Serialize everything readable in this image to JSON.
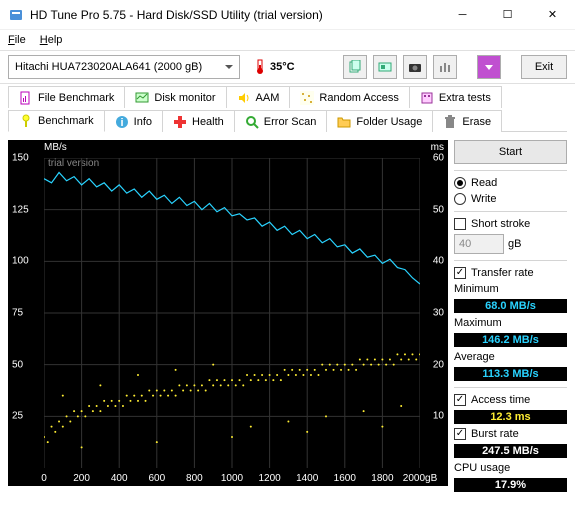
{
  "window": {
    "title": "HD Tune Pro 5.75 - Hard Disk/SSD Utility (trial version)"
  },
  "menu": {
    "file": "File",
    "help": "Help"
  },
  "toolbar": {
    "drive": "Hitachi HUA723020ALA641 (2000 gB)",
    "temp": "35°C",
    "exit": "Exit"
  },
  "tabs_row1": [
    {
      "label": "File Benchmark"
    },
    {
      "label": "Disk monitor"
    },
    {
      "label": "AAM"
    },
    {
      "label": "Random Access"
    },
    {
      "label": "Extra tests"
    }
  ],
  "tabs_row2": [
    {
      "label": "Benchmark"
    },
    {
      "label": "Info"
    },
    {
      "label": "Health"
    },
    {
      "label": "Error Scan"
    },
    {
      "label": "Folder Usage"
    },
    {
      "label": "Erase"
    }
  ],
  "side": {
    "start": "Start",
    "read": "Read",
    "write": "Write",
    "short_stroke": "Short stroke",
    "short_stroke_val": "40",
    "gb": "gB",
    "transfer_rate": "Transfer rate",
    "minimum": "Minimum",
    "min_val": "68.0 MB/s",
    "maximum": "Maximum",
    "max_val": "146.2 MB/s",
    "average": "Average",
    "avg_val": "113.3 MB/s",
    "access_time": "Access time",
    "access_val": "12.3 ms",
    "burst_rate": "Burst rate",
    "burst_val": "247.5 MB/s",
    "cpu_usage": "CPU usage",
    "cpu_val": "17.9%"
  },
  "chart_data": {
    "type": "line+scatter",
    "watermark": "trial version",
    "y1label": "MB/s",
    "y2label": "ms",
    "y1lim": [
      0,
      150
    ],
    "y2lim": [
      0,
      60
    ],
    "xlim": [
      0,
      2000
    ],
    "xunit": "gB",
    "x_ticks": [
      0,
      200,
      400,
      600,
      800,
      1000,
      1200,
      1400,
      1600,
      1800,
      2000
    ],
    "y1_ticks": [
      25,
      50,
      75,
      100,
      125,
      150
    ],
    "y2_ticks": [
      10,
      20,
      30,
      40,
      50,
      60
    ],
    "transfer_line": {
      "color": "#29d3ff",
      "x_step": 40,
      "y": [
        140,
        138,
        143,
        139,
        141,
        137,
        140,
        136,
        138,
        134,
        137,
        133,
        135,
        131,
        134,
        130,
        132,
        128,
        131,
        127,
        129,
        125,
        128,
        124,
        126,
        122,
        123,
        120,
        121,
        117,
        119,
        115,
        117,
        113,
        115,
        111,
        113,
        109,
        111,
        107,
        108,
        104,
        106,
        102,
        103,
        99,
        101,
        97,
        96,
        92,
        89
      ]
    },
    "access_scatter": {
      "color": "#ffee33",
      "points": [
        [
          0,
          6
        ],
        [
          20,
          5
        ],
        [
          40,
          8
        ],
        [
          60,
          7
        ],
        [
          80,
          9
        ],
        [
          100,
          8
        ],
        [
          120,
          10
        ],
        [
          140,
          9
        ],
        [
          160,
          11
        ],
        [
          180,
          10
        ],
        [
          200,
          11
        ],
        [
          220,
          10
        ],
        [
          240,
          12
        ],
        [
          260,
          11
        ],
        [
          280,
          12
        ],
        [
          300,
          11
        ],
        [
          320,
          13
        ],
        [
          340,
          12
        ],
        [
          360,
          13
        ],
        [
          380,
          12
        ],
        [
          400,
          13
        ],
        [
          420,
          12
        ],
        [
          440,
          14
        ],
        [
          460,
          13
        ],
        [
          480,
          14
        ],
        [
          500,
          13
        ],
        [
          520,
          14
        ],
        [
          540,
          13
        ],
        [
          560,
          15
        ],
        [
          580,
          14
        ],
        [
          600,
          15
        ],
        [
          620,
          14
        ],
        [
          640,
          15
        ],
        [
          660,
          14
        ],
        [
          680,
          15
        ],
        [
          700,
          14
        ],
        [
          720,
          16
        ],
        [
          740,
          15
        ],
        [
          760,
          16
        ],
        [
          780,
          15
        ],
        [
          800,
          16
        ],
        [
          820,
          15
        ],
        [
          840,
          16
        ],
        [
          860,
          15
        ],
        [
          880,
          17
        ],
        [
          900,
          16
        ],
        [
          920,
          17
        ],
        [
          940,
          16
        ],
        [
          960,
          17
        ],
        [
          980,
          16
        ],
        [
          1000,
          17
        ],
        [
          1020,
          16
        ],
        [
          1040,
          17
        ],
        [
          1060,
          16
        ],
        [
          1080,
          18
        ],
        [
          1100,
          17
        ],
        [
          1120,
          18
        ],
        [
          1140,
          17
        ],
        [
          1160,
          18
        ],
        [
          1180,
          17
        ],
        [
          1200,
          18
        ],
        [
          1220,
          17
        ],
        [
          1240,
          18
        ],
        [
          1260,
          17
        ],
        [
          1280,
          19
        ],
        [
          1300,
          18
        ],
        [
          1320,
          19
        ],
        [
          1340,
          18
        ],
        [
          1360,
          19
        ],
        [
          1380,
          18
        ],
        [
          1400,
          19
        ],
        [
          1420,
          18
        ],
        [
          1440,
          19
        ],
        [
          1460,
          18
        ],
        [
          1480,
          20
        ],
        [
          1500,
          19
        ],
        [
          1520,
          20
        ],
        [
          1540,
          19
        ],
        [
          1560,
          20
        ],
        [
          1580,
          19
        ],
        [
          1600,
          20
        ],
        [
          1620,
          19
        ],
        [
          1640,
          20
        ],
        [
          1660,
          19
        ],
        [
          1680,
          21
        ],
        [
          1700,
          20
        ],
        [
          1720,
          21
        ],
        [
          1740,
          20
        ],
        [
          1760,
          21
        ],
        [
          1780,
          20
        ],
        [
          1800,
          21
        ],
        [
          1820,
          20
        ],
        [
          1840,
          21
        ],
        [
          1860,
          20
        ],
        [
          1880,
          22
        ],
        [
          1900,
          21
        ],
        [
          1920,
          22
        ],
        [
          1940,
          21
        ],
        [
          1960,
          22
        ],
        [
          1980,
          21
        ],
        [
          2000,
          22
        ],
        [
          100,
          14
        ],
        [
          300,
          16
        ],
        [
          500,
          18
        ],
        [
          700,
          19
        ],
        [
          900,
          20
        ],
        [
          1100,
          8
        ],
        [
          1300,
          9
        ],
        [
          1500,
          10
        ],
        [
          1700,
          11
        ],
        [
          1900,
          12
        ],
        [
          200,
          4
        ],
        [
          600,
          5
        ],
        [
          1000,
          6
        ],
        [
          1400,
          7
        ],
        [
          1800,
          8
        ]
      ]
    }
  }
}
